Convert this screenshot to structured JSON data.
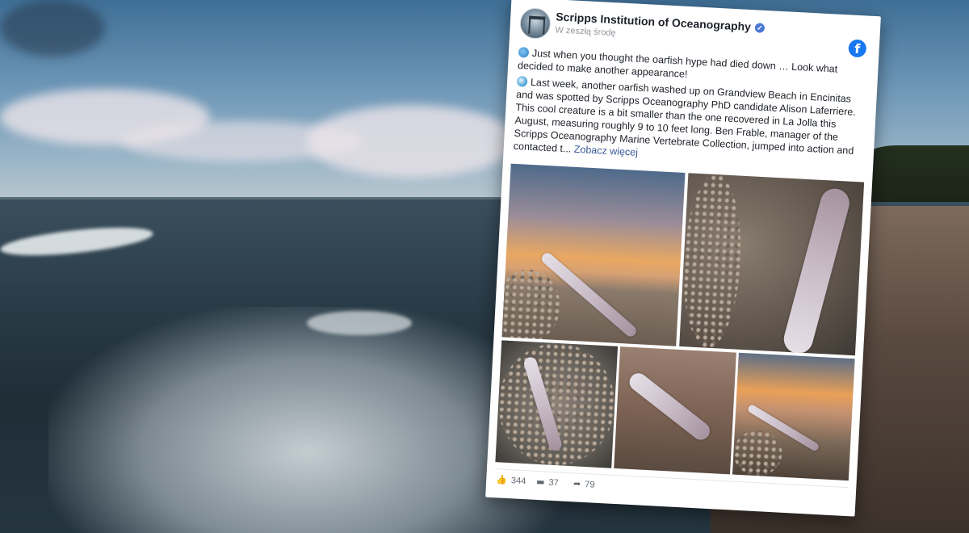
{
  "post": {
    "page_name": "Scripps Institution of Oceanography",
    "timestamp": "W zeszłą środę",
    "paragraph1": "Just when you thought the oarfish hype had died down … Look what decided to make another appearance!",
    "paragraph2": "Last week, another oarfish washed up on Grandview Beach in Encinitas and was spotted by Scripps Oceanography PhD candidate Alison Laferriere. This cool creature is a bit smaller than the one recovered in La Jolla this August, measuring roughly 9 to 10 feet long. Ben Frable, manager of the Scripps Oceanography Marine Vertebrate Collection, jumped into action and contacted t...",
    "see_more": "Zobacz więcej",
    "facebook_glyph": "f",
    "verified_glyph": "✓",
    "likes": "344",
    "comments": "37",
    "shares": "79"
  },
  "icons": {
    "like": "thumbs-up-icon",
    "comment": "comment-icon",
    "share": "share-arrow-icon"
  },
  "colors": {
    "facebook_blue": "#1877f2",
    "link": "#385898",
    "verified": "#4a78d6"
  }
}
